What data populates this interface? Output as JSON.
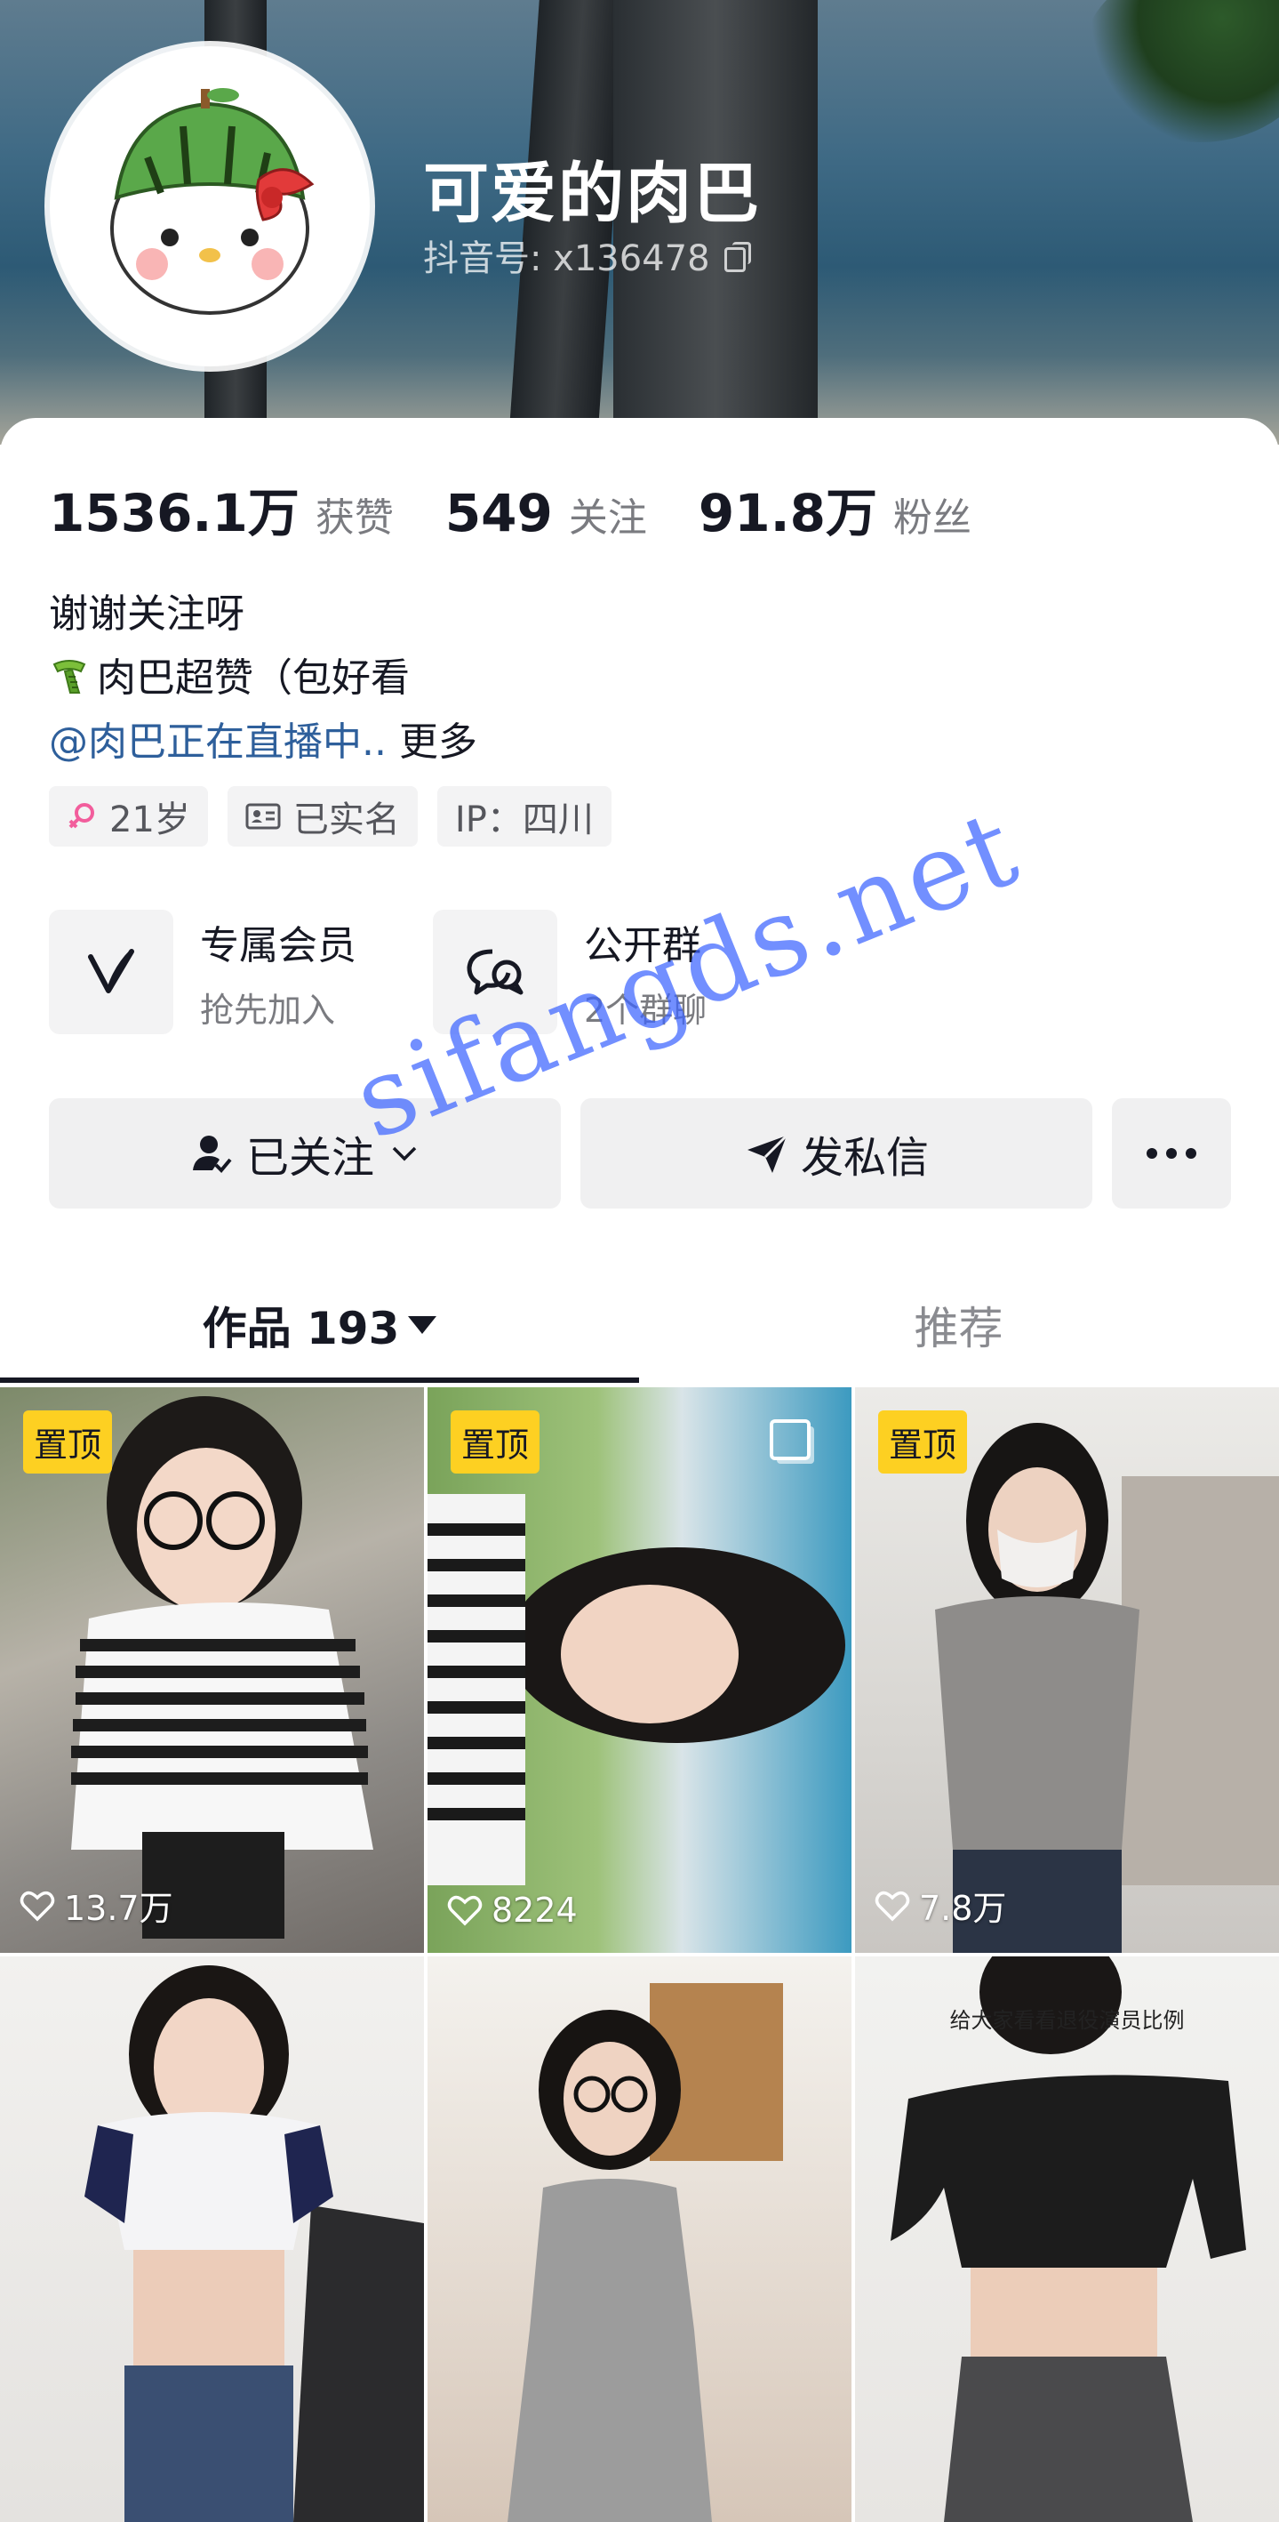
{
  "profile": {
    "nickname": "可爱的肉巴",
    "account_id": "抖音号: x136478"
  },
  "stats": [
    {
      "value": "1536.1万",
      "label": "获赞"
    },
    {
      "value": "549",
      "label": "关注"
    },
    {
      "value": "91.8万",
      "label": "粉丝"
    }
  ],
  "bio": {
    "line1": "谢谢关注呀",
    "line2": "肉巴超赞（包好看",
    "mention": "@肉巴正在直播中..",
    "more": "更多"
  },
  "tags": [
    {
      "label": "21岁",
      "icon": "female-icon"
    },
    {
      "label": "已实名",
      "icon": "id-card-icon"
    },
    {
      "label": "IP：四川",
      "icon": ""
    }
  ],
  "services": [
    {
      "title": "专属会员",
      "sub": "抢先加入",
      "icon": "member-v-icon"
    },
    {
      "title": "公开群",
      "sub": "2个群聊",
      "icon": "group-chat-icon"
    }
  ],
  "actions": {
    "follow": "已关注",
    "message": "发私信"
  },
  "tabs": {
    "works": "作品 193",
    "recommend": "推荐"
  },
  "videos": [
    {
      "pinned": "置顶",
      "likes": "13.7万"
    },
    {
      "pinned": "置顶",
      "likes": "8224"
    },
    {
      "pinned": "置顶",
      "likes": "7.8万"
    },
    {
      "pinned": "",
      "likes": ""
    },
    {
      "pinned": "",
      "likes": ""
    },
    {
      "pinned": "",
      "likes": "",
      "caption": "给大家看看退役演员比例"
    }
  ],
  "watermark": "sifangds.net",
  "colors": {
    "pin_badge": "#fdd022",
    "mention": "#2e5f9b",
    "watermark": "#3c64ff"
  }
}
